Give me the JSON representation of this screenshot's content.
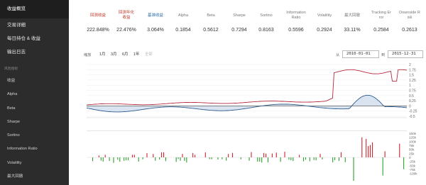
{
  "sidebar": {
    "items": [
      {
        "label": "收益概览",
        "active": true
      },
      {
        "label": "交易详细",
        "active": false
      },
      {
        "label": "每日持仓 & 收益",
        "active": false
      },
      {
        "label": "输出日志",
        "active": false
      }
    ],
    "section_label": "风险指标",
    "sub_items": [
      "收益",
      "Alpha",
      "Beta",
      "Sharpe",
      "Sortino",
      "Information Ratio",
      "Volatility",
      "最大回撤"
    ]
  },
  "metrics": [
    {
      "label": "回测收益",
      "value": "222.848%",
      "label_color": "#c0392b"
    },
    {
      "label": "回测年化\n收益",
      "value": "22.476%",
      "label_color": "#c0392b"
    },
    {
      "label": "基准收益",
      "value": "3.064%",
      "label_color": "#2e6da4"
    },
    {
      "label": "Alpha",
      "value": "0.1854",
      "label_color": "#777777"
    },
    {
      "label": "Beta",
      "value": "0.5612",
      "label_color": "#777777"
    },
    {
      "label": "Sharpe",
      "value": "0.7294",
      "label_color": "#777777"
    },
    {
      "label": "Sortino",
      "value": "0.8163",
      "label_color": "#777777"
    },
    {
      "label": "Information\nRatio",
      "value": "0.5596",
      "label_color": "#777777"
    },
    {
      "label": "Volatility",
      "value": "0.2924",
      "label_color": "#777777"
    },
    {
      "label": "最大回撤",
      "value": "33.11%",
      "label_color": "#777777"
    },
    {
      "label": "Tracking Er\nror",
      "value": "0.2584",
      "label_color": "#777777"
    },
    {
      "label": "Downside R\nisk",
      "value": "0.2613",
      "label_color": "#777777"
    }
  ],
  "controls": {
    "zoom_label": "缩放",
    "zoom_options": [
      "1月",
      "3月",
      "6月",
      "1年",
      "全部"
    ],
    "from_label": "从",
    "from_date": "2010-01-01",
    "to_label": "到",
    "to_date": "2015-12-31"
  },
  "colors": {
    "strategy": "#b7283e",
    "benchmark": "#2e5b8e",
    "benchmark_fill": "#c9d9ea",
    "positive": "#d2232f",
    "negative": "#2e9e2e"
  },
  "chart_data": [
    {
      "type": "line",
      "series": [],
      "ylim": [
        -0.5,
        2
      ],
      "y_ticks": [
        "2",
        "1.75",
        "1.5",
        "1.25",
        "1",
        "0.75",
        "0.5",
        "0.25",
        "0",
        "-0.25",
        "-0.5"
      ]
    },
    {
      "type": "bar",
      "ylim": [
        -150000,
        150000
      ],
      "y_ticks": [
        "150k",
        "125k",
        "100k",
        "75k",
        "50k",
        "25k",
        "0",
        "-25k",
        "-50k",
        "-75k",
        "-100k"
      ]
    }
  ]
}
